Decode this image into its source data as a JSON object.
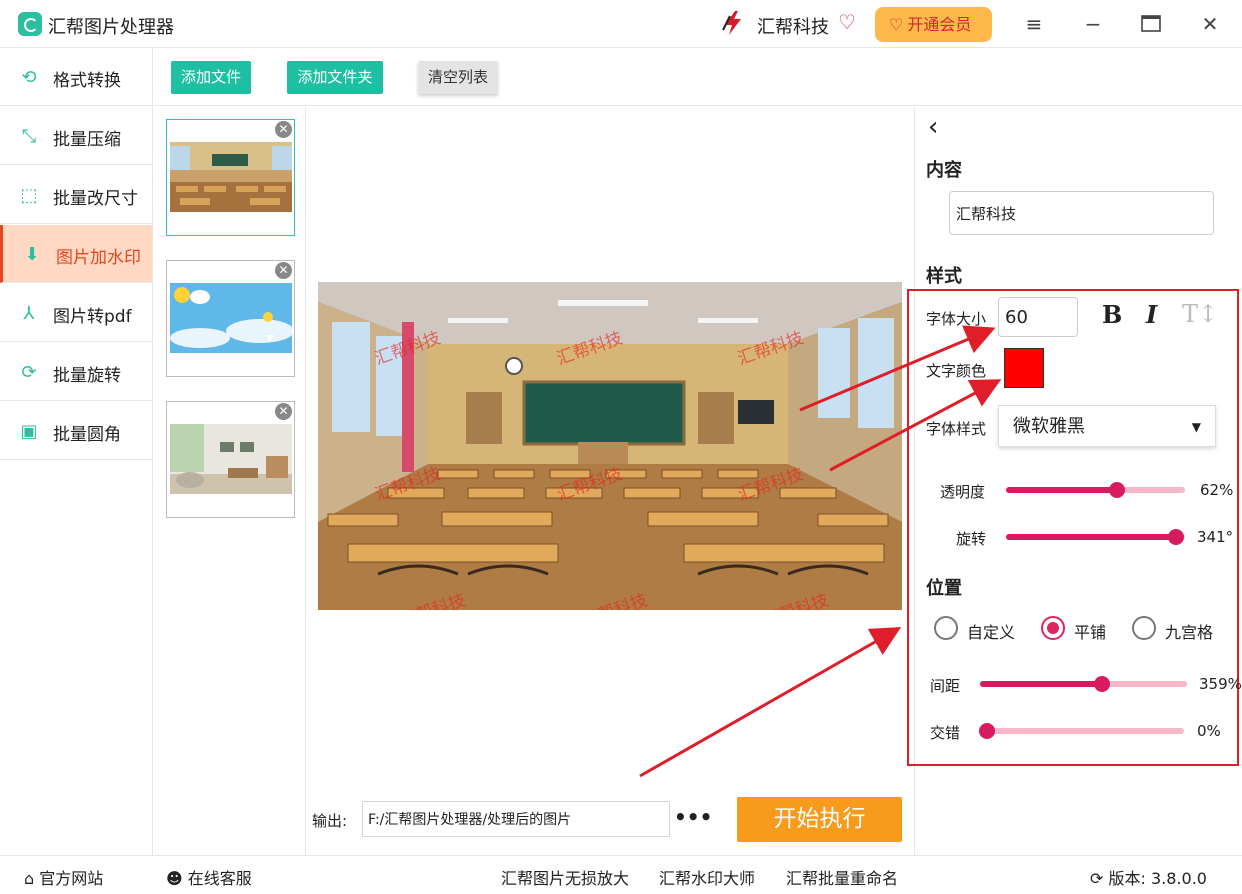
{
  "app": {
    "title": "汇帮图片处理器",
    "brand": "汇帮科技",
    "vip_label": "开通会员"
  },
  "sidebar": {
    "items": [
      {
        "label": "格式转换",
        "icon": "convert-icon"
      },
      {
        "label": "批量压缩",
        "icon": "compress-icon"
      },
      {
        "label": "批量改尺寸",
        "icon": "resize-icon"
      },
      {
        "label": "图片加水印",
        "icon": "watermark-icon",
        "active": true
      },
      {
        "label": "图片转pdf",
        "icon": "pdf-icon"
      },
      {
        "label": "批量旋转",
        "icon": "rotate-icon"
      },
      {
        "label": "批量圆角",
        "icon": "rounded-corner-icon"
      }
    ]
  },
  "toolbar": {
    "add_file": "添加文件",
    "add_folder": "添加文件夹",
    "clear_list": "清空列表"
  },
  "preview": {
    "watermark_text": "汇帮科技"
  },
  "output": {
    "label": "输出:",
    "path": "F:/汇帮图片处理器/处理后的图片",
    "more": "•••",
    "run": "开始执行"
  },
  "panel": {
    "content_title": "内容",
    "content_value": "汇帮科技",
    "style_title": "样式",
    "font_size_label": "字体大小",
    "font_size_value": "60",
    "bold": "B",
    "italic": "I",
    "text_color_label": "文字颜色",
    "text_color": "#ff0000",
    "font_style_label": "字体样式",
    "font_style_value": "微软雅黑",
    "opacity_label": "透明度",
    "opacity_value": "62%",
    "opacity": 0.62,
    "rotation_label": "旋转",
    "rotation_value": "341°",
    "rotation": 341,
    "position_title": "位置",
    "pos_custom": "自定义",
    "pos_tile": "平铺",
    "pos_grid": "九宫格",
    "spacing_label": "间距",
    "spacing_value": "359%",
    "spacing_fraction": 0.59,
    "stagger_label": "交错",
    "stagger_value": "0%",
    "stagger": 0
  },
  "statusbar": {
    "website": "官方网站",
    "support": "在线客服",
    "link1": "汇帮图片无损放大",
    "link2": "汇帮水印大师",
    "link3": "汇帮批量重命名",
    "version": "版本: 3.8.0.0"
  },
  "colors": {
    "accent": "#1fbfa3",
    "active_text": "#e8471d",
    "slider": "#d81b60",
    "run": "#f89a1c"
  }
}
